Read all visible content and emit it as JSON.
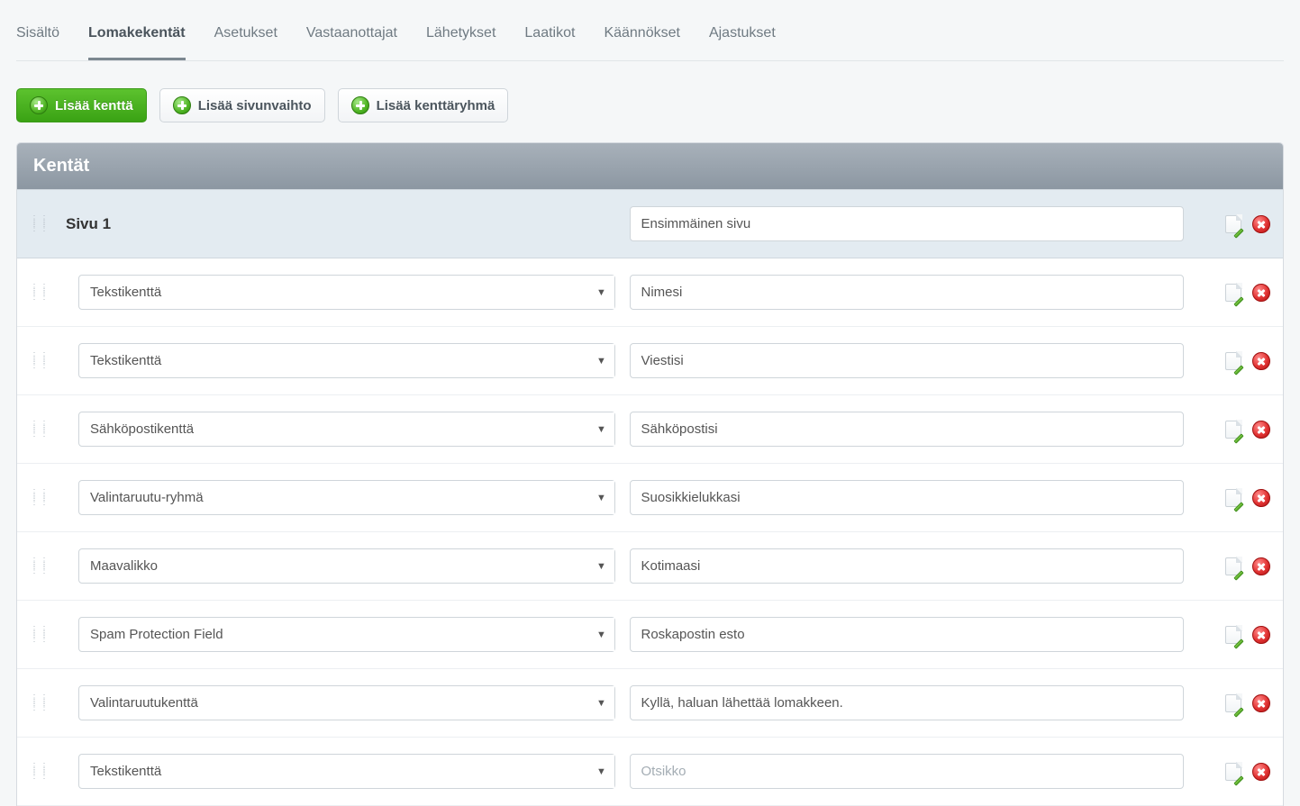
{
  "tabs": [
    {
      "label": "Sisältö",
      "active": false
    },
    {
      "label": "Lomakekentät",
      "active": true
    },
    {
      "label": "Asetukset",
      "active": false
    },
    {
      "label": "Vastaanottajat",
      "active": false
    },
    {
      "label": "Lähetykset",
      "active": false
    },
    {
      "label": "Laatikot",
      "active": false
    },
    {
      "label": "Käännökset",
      "active": false
    },
    {
      "label": "Ajastukset",
      "active": false
    }
  ],
  "toolbar": {
    "add_field": "Lisää kenttä",
    "add_pagebreak": "Lisää sivunvaihto",
    "add_fieldgroup": "Lisää kenttäryhmä"
  },
  "panel": {
    "title": "Kentät"
  },
  "page": {
    "label": "Sivu 1",
    "name_value": "Ensimmäinen sivu"
  },
  "fields": [
    {
      "type": "Tekstikenttä",
      "label_value": "Nimesi",
      "placeholder": ""
    },
    {
      "type": "Tekstikenttä",
      "label_value": "Viestisi",
      "placeholder": ""
    },
    {
      "type": "Sähköpostikenttä",
      "label_value": "Sähköpostisi",
      "placeholder": ""
    },
    {
      "type": "Valintaruutu-ryhmä",
      "label_value": "Suosikkielukkasi",
      "placeholder": ""
    },
    {
      "type": "Maavalikko",
      "label_value": "Kotimaasi",
      "placeholder": ""
    },
    {
      "type": "Spam Protection Field",
      "label_value": "Roskapostin esto",
      "placeholder": ""
    },
    {
      "type": "Valintaruutukenttä",
      "label_value": "Kyllä, haluan lähettää lomakkeen.",
      "placeholder": ""
    },
    {
      "type": "Tekstikenttä",
      "label_value": "",
      "placeholder": "Otsikko"
    }
  ]
}
